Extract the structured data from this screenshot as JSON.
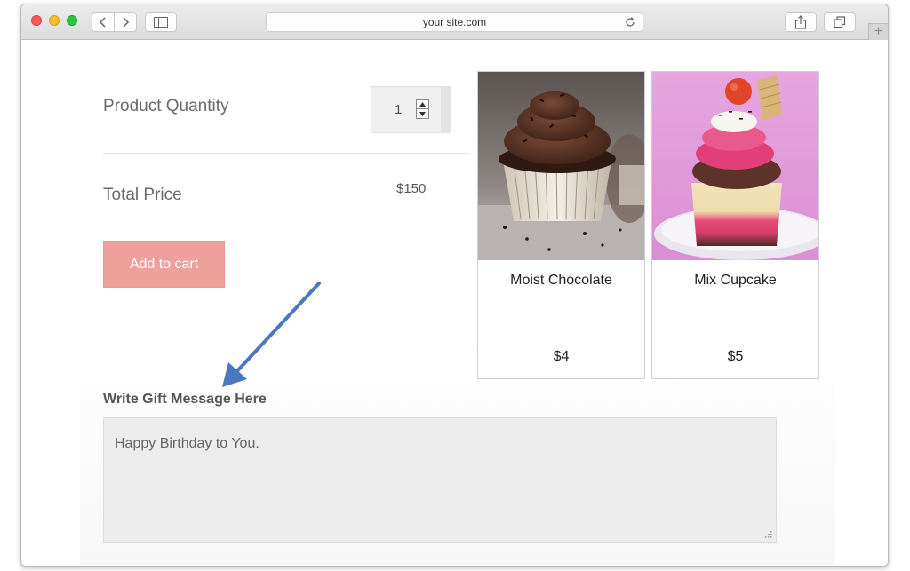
{
  "browser": {
    "url": "your site.com",
    "icons": {
      "back": "chevron-left-icon",
      "forward": "chevron-right-icon",
      "sidebar": "sidebar-icon",
      "reload": "reload-icon",
      "share": "share-icon",
      "tabs": "tabs-icon",
      "new_tab": "plus-icon"
    },
    "new_tab_glyph": "+"
  },
  "order": {
    "quantity_label": "Product Quantity",
    "quantity_value": "1",
    "total_label": "Total Price",
    "total_value": "$150",
    "add_to_cart_label": "Add to cart",
    "accent_color": "#f0a09b"
  },
  "products": [
    {
      "name": "Moist Chocolate",
      "price": "$4"
    },
    {
      "name": "Mix Cupcake",
      "price": "$5"
    }
  ],
  "gift": {
    "label": "Write Gift Message Here",
    "message": "Happy Birthday to You."
  },
  "annotation": {
    "arrow_color": "#4a78c0"
  }
}
